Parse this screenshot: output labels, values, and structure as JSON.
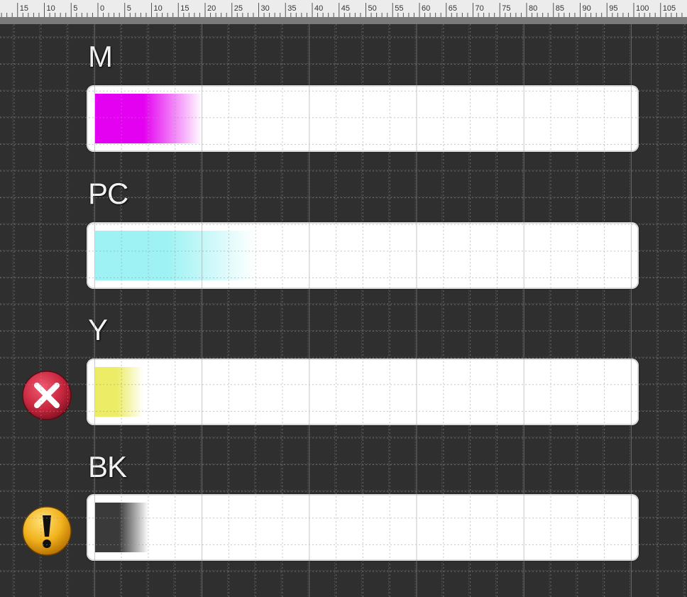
{
  "ruler": {
    "ticks": [
      "15",
      "10",
      "5",
      "0",
      "5",
      "10",
      "15",
      "20",
      "25",
      "30",
      "35",
      "40",
      "45",
      "50",
      "55",
      "60",
      "65",
      "70",
      "75",
      "80",
      "85",
      "90",
      "95",
      "100",
      "105"
    ]
  },
  "inks": [
    {
      "label": "M",
      "level": 0.2,
      "color": "#e400f0",
      "status": "none"
    },
    {
      "label": "PC",
      "level": 0.3,
      "color": "#9ef2f4",
      "status": "none"
    },
    {
      "label": "Y",
      "level": 0.09,
      "color": "#ecec66",
      "status": "error",
      "status_icon": "error-x-icon"
    },
    {
      "label": "BK",
      "level": 0.1,
      "color": "#3a3a3a",
      "status": "warning",
      "status_icon": "warning-exclamation-icon"
    }
  ],
  "colors": {
    "background": "#2f2f2f",
    "bar": "#ffffff",
    "error": "#c8283f",
    "warning": "#f2b21c"
  }
}
